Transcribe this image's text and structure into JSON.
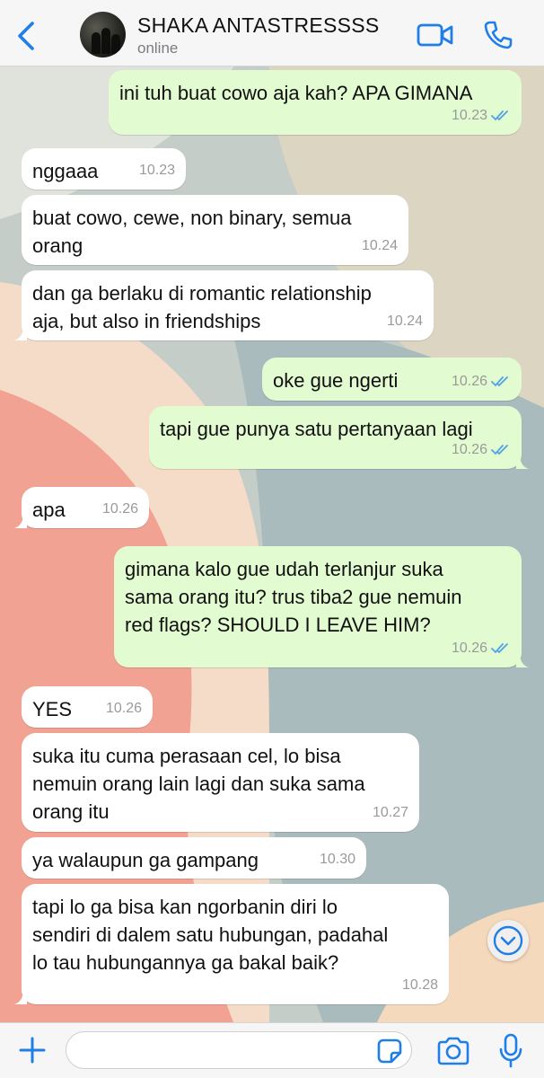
{
  "header": {
    "back_icon": "chevron-left-icon",
    "contact_name": "SHAKA ANTASTRESSSS",
    "status": "online",
    "video_icon": "video-camera-icon",
    "call_icon": "phone-icon",
    "accent_color": "#1f7ee8"
  },
  "messages": [
    {
      "direction": "out",
      "text": "ini tuh buat cowo aja kah? APA GIMANA",
      "time": "10.23",
      "read": true
    },
    {
      "direction": "in",
      "text": "nggaaa",
      "time": "10.23"
    },
    {
      "direction": "in",
      "text": "buat cowo, cewe, non binary, semua\norang",
      "time": "10.24"
    },
    {
      "direction": "in",
      "text": "dan ga berlaku di romantic relationship\naja, but also in friendships",
      "time": "10.24"
    },
    {
      "direction": "out",
      "text": "oke gue ngerti",
      "time": "10.26",
      "read": true
    },
    {
      "direction": "out",
      "text": "tapi gue punya satu pertanyaan lagi",
      "time": "10.26",
      "read": true
    },
    {
      "direction": "in",
      "text": "apa",
      "time": "10.26"
    },
    {
      "direction": "out",
      "text": "gimana kalo gue udah terlanjur suka\nsama orang itu? trus tiba2 gue nemuin\nred flags? SHOULD I LEAVE HIM?",
      "time": "10.26",
      "read": true
    },
    {
      "direction": "in",
      "text": "YES",
      "time": "10.26"
    },
    {
      "direction": "in",
      "text": "suka itu cuma perasaan cel, lo bisa\nnemuin orang lain lagi dan suka sama\norang itu",
      "time": "10.27"
    },
    {
      "direction": "in",
      "text": "ya walaupun ga gampang",
      "time": "10.30"
    },
    {
      "direction": "in",
      "text": "tapi lo ga bisa kan ngorbanin diri lo\nsendiri di dalem satu hubungan, padahal\nlo tau hubungannya ga bakal baik?",
      "time": "10.28"
    }
  ],
  "scroll_down_icon": "chevron-down-circle-icon",
  "composer": {
    "plus_icon": "plus-icon",
    "input_value": "",
    "input_placeholder": "",
    "sticker_icon": "sticker-icon",
    "camera_icon": "camera-icon",
    "mic_icon": "microphone-icon"
  },
  "colors": {
    "incoming_bubble": "#ffffff",
    "outgoing_bubble": "#e2fbd0",
    "read_ticks": "#4fa3e8",
    "wallpaper_coral": "#f2a293",
    "wallpaper_slate": "#a9bbbd",
    "wallpaper_peach": "#f5d9bd"
  }
}
